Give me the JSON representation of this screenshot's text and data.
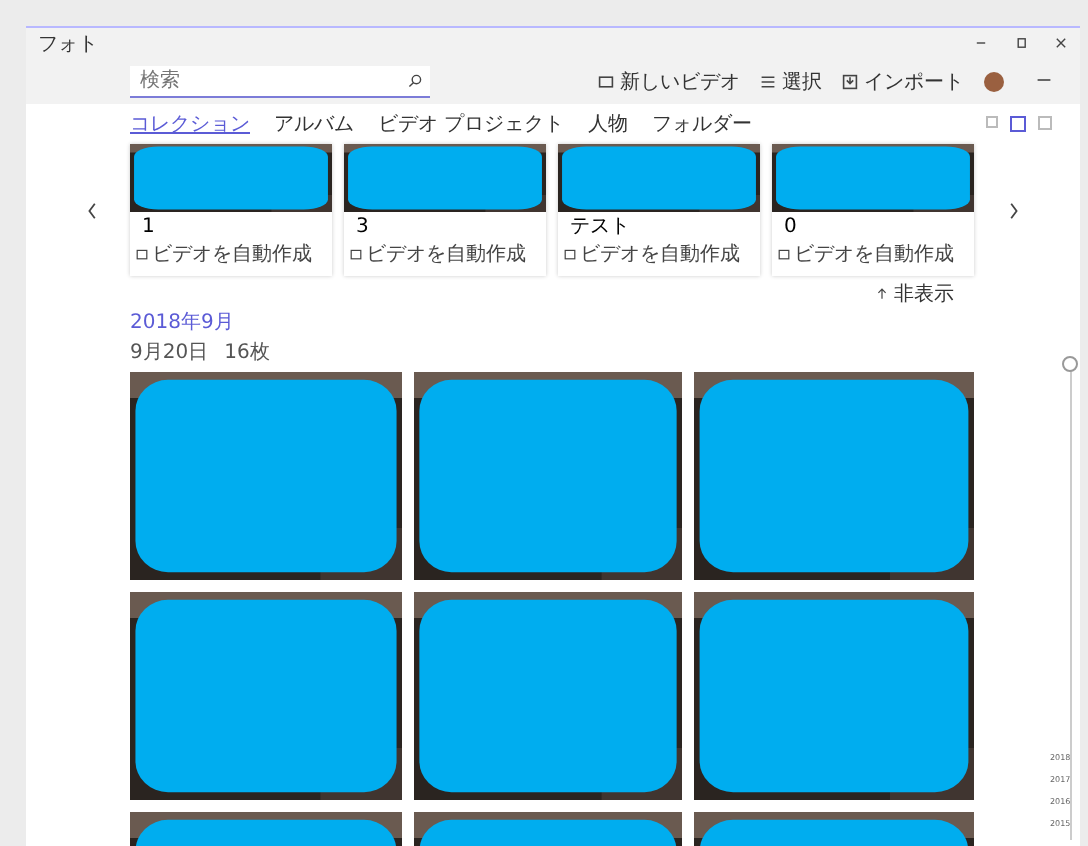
{
  "window": {
    "title": "フォト"
  },
  "search": {
    "placeholder": "検索"
  },
  "toolbar": [
    {
      "kind": "video",
      "label": "新しいビデオ"
    },
    {
      "kind": "select",
      "label": "選択"
    },
    {
      "kind": "import",
      "label": "インポート"
    }
  ],
  "tabs": [
    {
      "label": "コレクション",
      "selected": true
    },
    {
      "label": "アルバム",
      "selected": false
    },
    {
      "label": "ビデオ プロジェクト",
      "selected": false
    },
    {
      "label": "人物",
      "selected": false
    },
    {
      "label": "フォルダー",
      "selected": false
    }
  ],
  "view_options": [
    {
      "kind": "small",
      "selected": false
    },
    {
      "kind": "medium",
      "selected": true
    },
    {
      "kind": "large",
      "selected": false
    }
  ],
  "albums": [
    {
      "name": "1",
      "caption": "ビデオを自動作成"
    },
    {
      "name": "3",
      "caption": "ビデオを自動作成"
    },
    {
      "name": "テスト",
      "caption": "ビデオを自動作成"
    },
    {
      "name": "0",
      "caption": "ビデオを自動作成"
    }
  ],
  "hide_button": {
    "label": "非表示"
  },
  "month": "2018年9月",
  "day": {
    "date": "9月20日",
    "count": "16枚"
  },
  "timeline": [
    "2018",
    "2017",
    "2016",
    "2015"
  ]
}
